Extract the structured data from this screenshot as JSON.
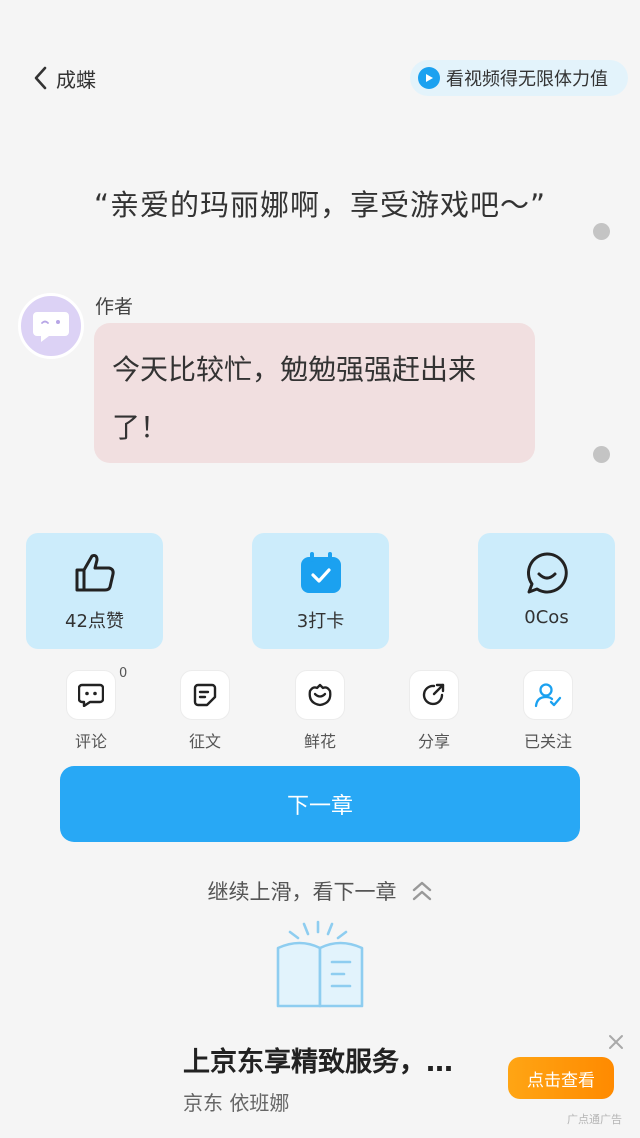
{
  "header": {
    "back_label": "成蝶",
    "video_button": "看视频得无限体力值"
  },
  "quote": "“亲爱的玛丽娜啊，享受游戏吧～”",
  "author": {
    "label": "作者",
    "message_line1": "今天比较忙，勉勉强强赶出来",
    "message_line2": "了！"
  },
  "stats": [
    {
      "label": "42点赞",
      "icon": "thumbs-up-icon"
    },
    {
      "label": "3打卡",
      "icon": "calendar-check-icon"
    },
    {
      "label": "0Cos",
      "icon": "chat-bubble-icon"
    }
  ],
  "actions": [
    {
      "label": "评论",
      "icon": "comment-icon",
      "badge": "0"
    },
    {
      "label": "征文",
      "icon": "essay-icon"
    },
    {
      "label": "鲜花",
      "icon": "flower-icon"
    },
    {
      "label": "分享",
      "icon": "share-icon"
    },
    {
      "label": "已关注",
      "icon": "followed-user-icon"
    }
  ],
  "next_button": "下一章",
  "swipe_hint": "继续上滑，看下一章",
  "ad": {
    "title": "上京东享精致服务，…",
    "subtitle": "京东 依班娜",
    "cta": "点击查看",
    "mark": "广点通广告"
  },
  "colors": {
    "accent": "#28a8f5",
    "card_bg": "#ccecfb",
    "bubble_bg": "#f1dfe0",
    "cta_orange": "#ff8a00"
  }
}
